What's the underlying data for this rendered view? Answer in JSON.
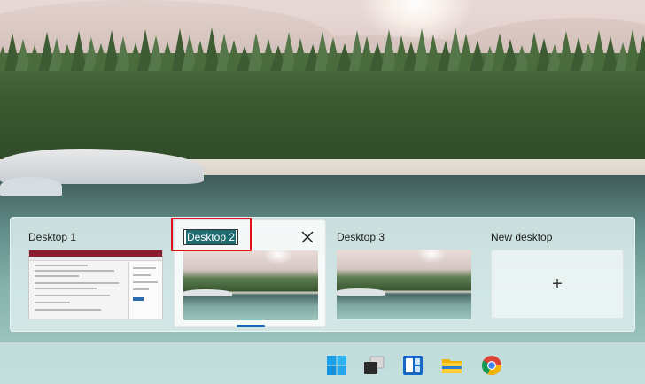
{
  "task_view": {
    "desktops": [
      {
        "label": "Desktop 1"
      },
      {
        "label": "Desktop 2",
        "editing": true
      },
      {
        "label": "Desktop 3"
      }
    ],
    "new_desktop": {
      "label": "New desktop",
      "plus": "+"
    }
  },
  "taskbar": {
    "icons": [
      "windows-start-icon",
      "task-view-icon",
      "widgets-icon",
      "file-explorer-icon",
      "chrome-icon"
    ]
  },
  "colors": {
    "highlight": "#e2101a",
    "active_indicator": "#1666c0",
    "selection": "#1e6b70"
  }
}
